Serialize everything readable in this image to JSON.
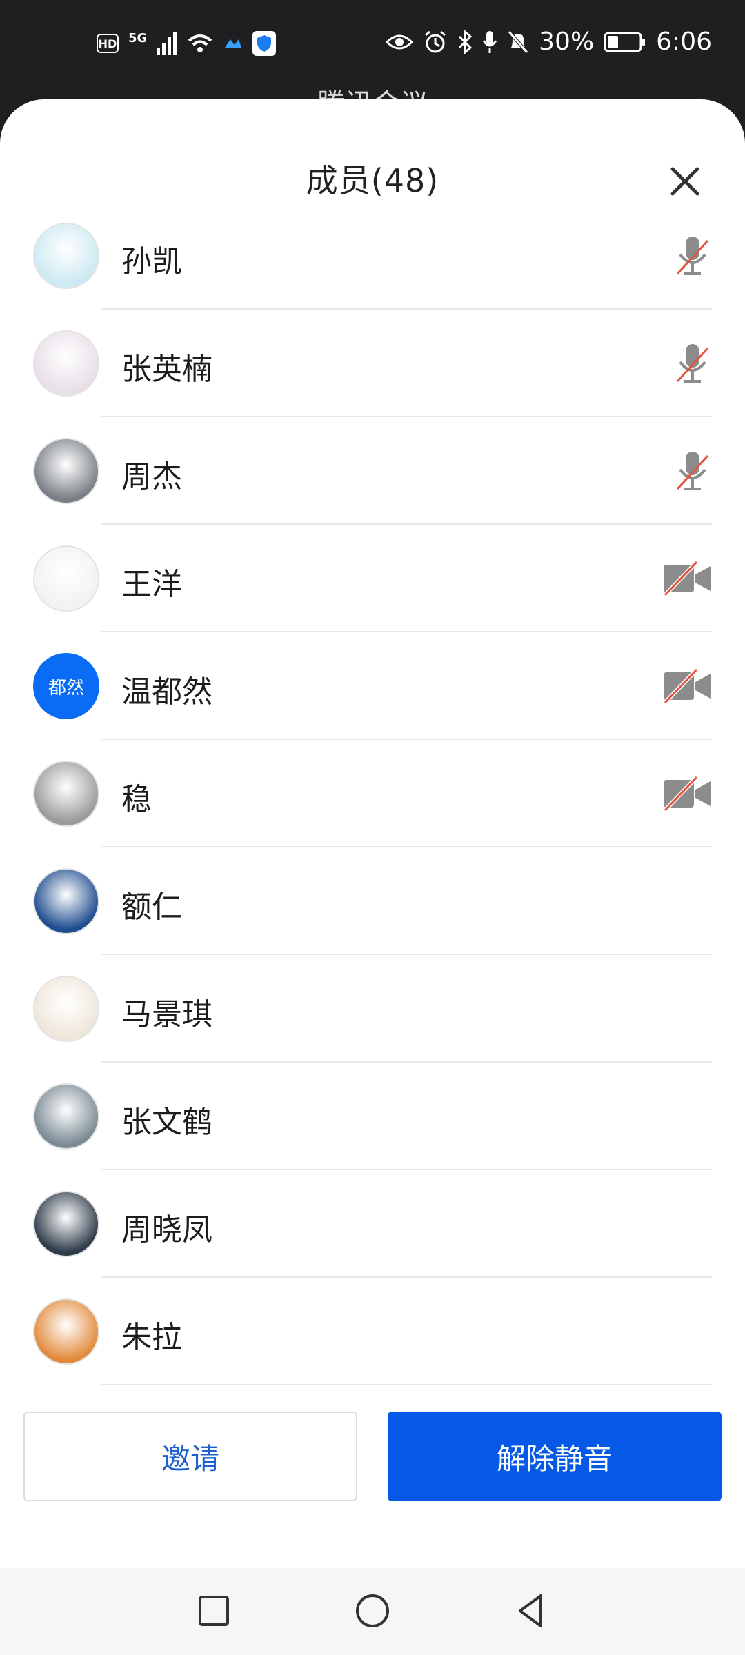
{
  "status_bar": {
    "hd_label": "HD",
    "network_label": "5G",
    "battery_percent": "30%",
    "time": "6:06"
  },
  "background_app_title": "腾讯会议",
  "sheet": {
    "title": "成员(48)"
  },
  "members": [
    {
      "name": "孙凯",
      "status": "mic-muted",
      "avatar_color": "#cde9f3"
    },
    {
      "name": "张英楠",
      "status": "mic-muted",
      "avatar_color": "#e8dfe8"
    },
    {
      "name": "周杰",
      "status": "mic-muted",
      "avatar_color": "#7a7f86"
    },
    {
      "name": "王洋",
      "status": "video-off",
      "avatar_color": "#f2f2f2"
    },
    {
      "name": "温都然",
      "status": "video-off",
      "avatar_text": "都然",
      "avatar_color": "#0a6cf5"
    },
    {
      "name": "稳",
      "status": "video-off",
      "avatar_color": "#9a9a9a"
    },
    {
      "name": "额仁",
      "status": "none",
      "avatar_color": "#1f4c8f"
    },
    {
      "name": "马景琪",
      "status": "none",
      "avatar_color": "#efe6da"
    },
    {
      "name": "张文鹤",
      "status": "none",
      "avatar_color": "#7a8a94"
    },
    {
      "name": "周晓凤",
      "status": "none",
      "avatar_color": "#2e3b4a"
    },
    {
      "name": "朱拉",
      "status": "none",
      "avatar_color": "#e28a3b"
    }
  ],
  "buttons": {
    "invite": "邀请",
    "unmute": "解除静音"
  },
  "colors": {
    "primary_blue": "#0559e6",
    "muted_red": "#e5533d",
    "icon_gray": "#8c8c8c"
  }
}
